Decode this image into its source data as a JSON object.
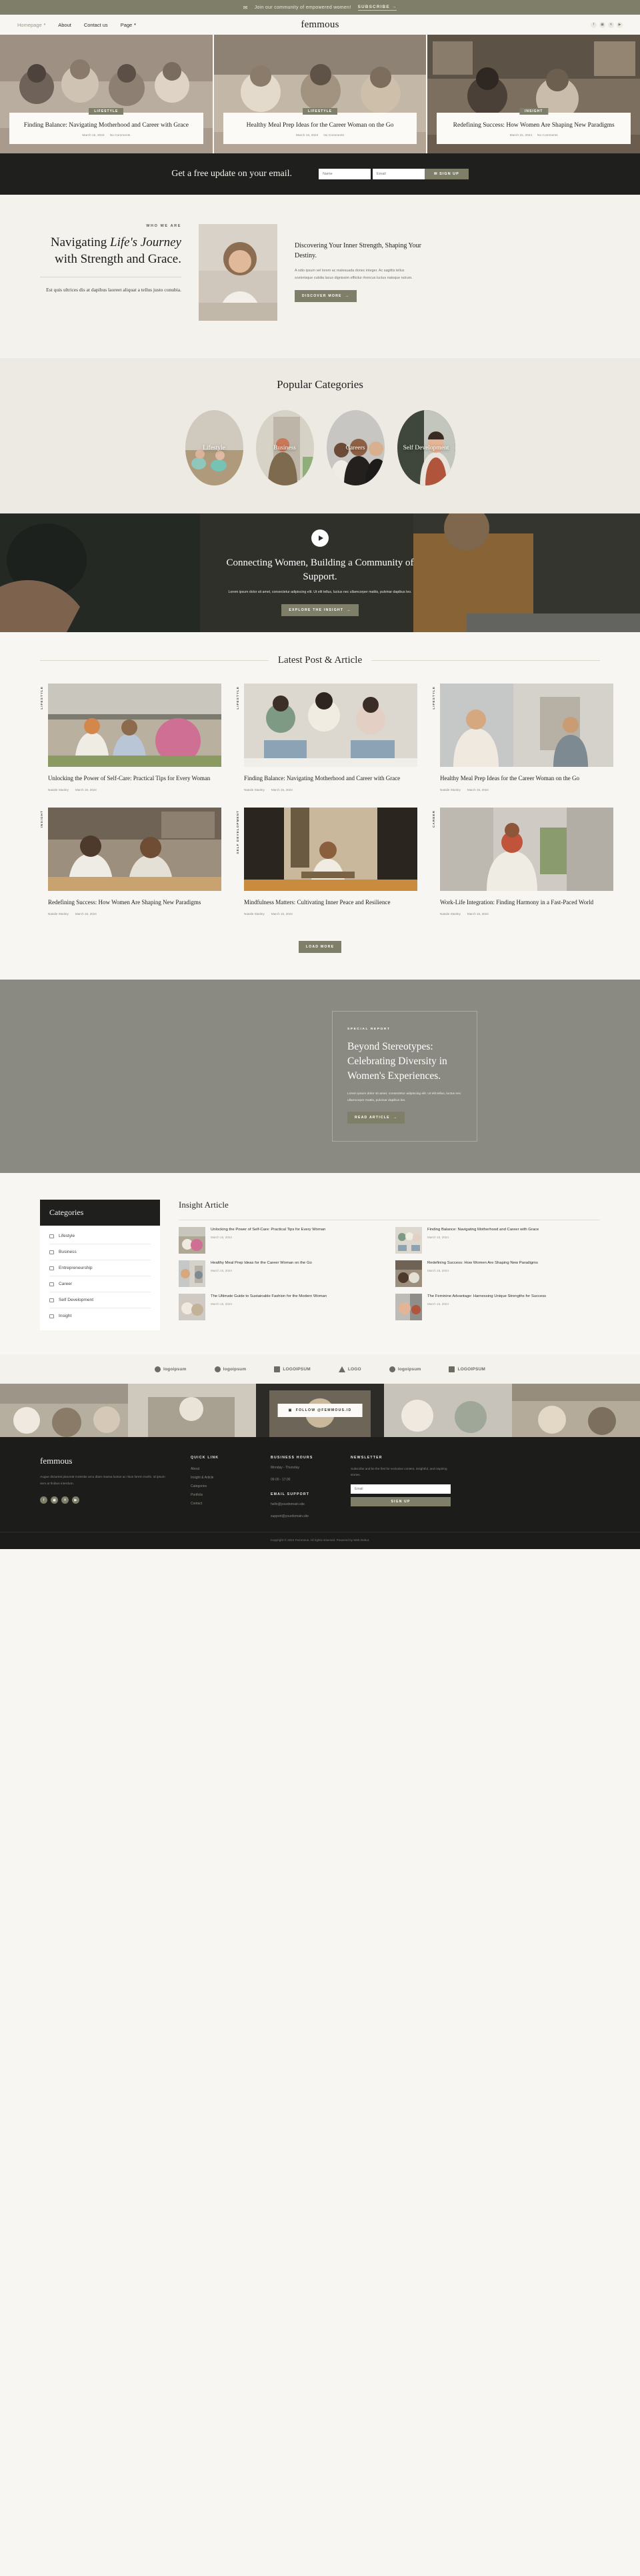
{
  "topbar": {
    "message": "Join our community of empowered women!",
    "cta": "SUBSCRIBE",
    "arrow": "→",
    "envelope_icon": "✉"
  },
  "nav": {
    "items": [
      {
        "label": "Homepage",
        "caret": "⌵"
      },
      {
        "label": "About",
        "caret": ""
      },
      {
        "label": "Contact us",
        "caret": ""
      },
      {
        "label": "Page",
        "caret": "⌵"
      }
    ],
    "brand": "femmous",
    "socials": [
      {
        "name": "facebook-icon",
        "glyph": "f"
      },
      {
        "name": "instagram-icon",
        "glyph": "▣"
      },
      {
        "name": "x-icon",
        "glyph": "✕"
      },
      {
        "name": "youtube-icon",
        "glyph": "▶"
      }
    ]
  },
  "hero": {
    "cards": [
      {
        "badge": "LIFESTYLE",
        "title": "Finding Balance: Navigating Motherhood and Career with Grace",
        "date": "March 15, 2024",
        "comments": "No Comments"
      },
      {
        "badge": "LIFESTYLE",
        "title": "Healthy Meal Prep Ideas for the Career Woman on the Go",
        "date": "March 15, 2024",
        "comments": "No Comments"
      },
      {
        "badge": "INSIGHT",
        "title": "Redefining Success: How Women Are Shaping New Paradigms",
        "date": "March 15, 2024",
        "comments": "No Comments"
      }
    ]
  },
  "email_band": {
    "heading": "Get a free update on your email.",
    "name_placeholder": "Name",
    "email_placeholder": "Email",
    "button": "SIGN UP",
    "button_icon": "✉"
  },
  "who_we_are": {
    "kicker": "WHO WE ARE",
    "heading_a": "Navigating ",
    "heading_em": "Life's Journey",
    "heading_b": " with Strength and Grace.",
    "paragraph": "Est quis ultrices dis at dapibus laoreet aliquat a tellus justo conubia.",
    "right_heading": "Discovering Your Inner Strength, Shaping Your Destiny.",
    "right_paragraph": "A odio ipsum vel lorem ac malesuada donec integer. Ac sagittis tellus scelerisque cubilia lacus dignissim efficitur rhoncus luctus natoque rutrum.",
    "cta": "DISCOVER MORE",
    "cta_arrow": "→"
  },
  "popular_categories": {
    "title": "Popular Categories",
    "items": [
      {
        "label": "Lifestyle"
      },
      {
        "label": "Business"
      },
      {
        "label": "Careers"
      },
      {
        "label": "Self Development"
      }
    ]
  },
  "video_section": {
    "heading": "Connecting Women, Building a Community of Support.",
    "paragraph": "Lorem ipsum dolor sit amet, consectetur adipiscing elit. Ut elit tellus, luctus nec ullamcorper mattis, pulvinar dapibus leo.",
    "cta": "EXPLORE THE INSIGHT",
    "cta_arrow": "→",
    "play_icon": "play-icon"
  },
  "latest": {
    "title": "Latest Post & Article",
    "load_more": "LOAD MORE",
    "posts": [
      {
        "tag": "LIFESTYLE",
        "title": "Unlocking the Power of Self-Care: Practical Tips for Every Woman",
        "author": "Natalie Stanley",
        "date": "March 15, 2024"
      },
      {
        "tag": "LIFESTYLE",
        "title": "Finding Balance: Navigating Motherhood and Career with Grace",
        "author": "Natalie Stanley",
        "date": "March 15, 2024"
      },
      {
        "tag": "LIFESTYLE",
        "title": "Healthy Meal Prep Ideas for the Career Woman on the Go",
        "author": "Natalie Stanley",
        "date": "March 15, 2024"
      },
      {
        "tag": "INSIGHT",
        "title": "Redefining Success: How Women Are Shaping New Paradigms",
        "author": "Natalie Stanley",
        "date": "March 15, 2024"
      },
      {
        "tag": "SELF DEVELOPMENT",
        "title": "Mindfulness Matters: Cultivating Inner Peace and Resilience",
        "author": "Natalie Stanley",
        "date": "March 15, 2024"
      },
      {
        "tag": "CAREER",
        "title": "Work-Life Integration: Finding Harmony in a Fast-Paced World",
        "author": "Natalie Stanley",
        "date": "March 15, 2024"
      }
    ]
  },
  "special_report": {
    "kicker": "SPECIAL REPORT",
    "heading": "Beyond Stereotypes: Celebrating Diversity in Women's Experiences.",
    "paragraph": "Lorem ipsum dolor sit amet, consectetur adipiscing elit. Ut elit tellus, luctus nec ullamcorper mattis, pulvinar dapibus leo.",
    "cta": "READ ARTICLE",
    "cta_arrow": "→"
  },
  "sidebar": {
    "title": "Categories",
    "items": [
      {
        "label": "Lifestyle"
      },
      {
        "label": "Business"
      },
      {
        "label": "Entrepreneurship"
      },
      {
        "label": "Career"
      },
      {
        "label": "Self Development"
      },
      {
        "label": "Insight"
      }
    ]
  },
  "insight_article": {
    "title": "Insight Article",
    "items": [
      {
        "title": "Unlocking the Power of Self-Care: Practical Tips for Every Woman",
        "date": "March 15, 2024"
      },
      {
        "title": "Finding Balance: Navigating Motherhood and Career with Grace",
        "date": "March 15, 2024"
      },
      {
        "title": "Healthy Meal Prep Ideas for the Career Woman on the Go",
        "date": "March 15, 2024"
      },
      {
        "title": "Redefining Success: How Women Are Shaping New Paradigms",
        "date": "March 15, 2024"
      },
      {
        "title": "The Ultimate Guide to Sustainable Fashion for the Modern Woman",
        "date": "March 15, 2024"
      },
      {
        "title": "The Feminine Advantage: Harnessing Unique Strengths for Success",
        "date": "March 15, 2024"
      }
    ]
  },
  "logos": [
    {
      "label": "logoipsum"
    },
    {
      "label": "logoipsum"
    },
    {
      "label": "LOGOIPSUM"
    },
    {
      "label": "LOGO"
    },
    {
      "label": "logoipsum"
    },
    {
      "label": "LOGOIPSUM"
    }
  ],
  "instagram": {
    "pill": "FOLLOW @FEMMOUS.ID",
    "icon": "▣"
  },
  "footer": {
    "brand": "femmous",
    "about": "Augue dictumst placerat molestie arcu diam massa luctus ac risus lorem morbi. Id ipsum sem at finibus interdum.",
    "socials": [
      {
        "name": "facebook-icon",
        "glyph": "f"
      },
      {
        "name": "instagram-icon",
        "glyph": "▣"
      },
      {
        "name": "x-icon",
        "glyph": "✕"
      },
      {
        "name": "youtube-icon",
        "glyph": "▶"
      }
    ],
    "quick_link": {
      "title": "QUICK LINK",
      "items": [
        "About",
        "Insight & Article",
        "Categories",
        "Portfolio",
        "Contact"
      ]
    },
    "business_hours": {
      "title": "BUSINESS HOURS",
      "lines": [
        "Monday - Thursday",
        "09.00 - 17.00"
      ],
      "support_title": "EMAIL SUPPORT",
      "support_lines": [
        "hello@yourdomain.site",
        "support@yourdomain.site"
      ]
    },
    "newsletter": {
      "title": "NEWSLETTER",
      "text": "Subscribe and be the first for exclusive content, insightful, and inspiring stories.",
      "placeholder": "Email",
      "button": "SIGN UP"
    },
    "copyright": "Copyright © 2024 Femmous. All rights reserved. Powered by Web Debut."
  },
  "colors": {
    "accent": "#7f7f69",
    "dark": "#1f1f1d",
    "cream": "#f7f6f2",
    "beige": "#eceae3"
  }
}
